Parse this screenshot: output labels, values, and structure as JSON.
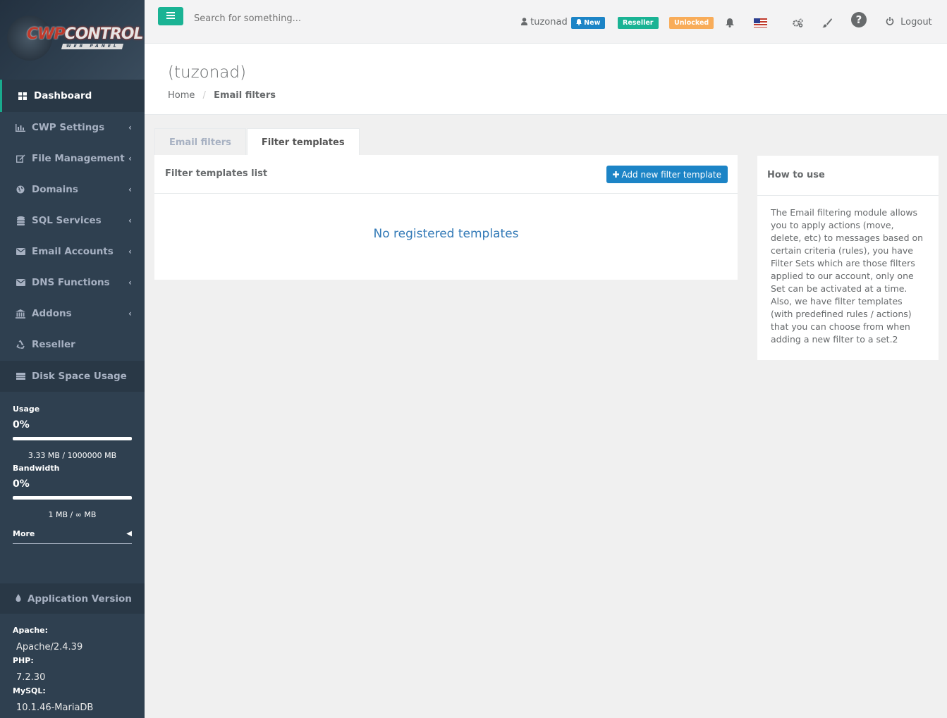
{
  "sidebar": {
    "logo": {
      "brand_left": "CWP",
      "brand_right": "CONTROL",
      "sub": "WEB PANEL"
    },
    "items": [
      {
        "label": "Dashboard",
        "icon": "dashboard-icon"
      },
      {
        "label": "CWP Settings",
        "icon": "bar-chart-icon"
      },
      {
        "label": "File Management",
        "icon": "edit-icon"
      },
      {
        "label": "Domains",
        "icon": "globe-icon"
      },
      {
        "label": "SQL Services",
        "icon": "database-icon"
      },
      {
        "label": "Email Accounts",
        "icon": "envelope-icon"
      },
      {
        "label": "DNS Functions",
        "icon": "envelope-icon"
      },
      {
        "label": "Addons",
        "icon": "bank-icon"
      },
      {
        "label": "Reseller",
        "icon": "recycle-icon"
      }
    ],
    "disk": {
      "heading": "Disk Space Usage",
      "usage_label": "Usage",
      "usage_pct": "0%",
      "usage_detail": "3.33 MB / 1000000 MB",
      "bandwidth_label": "Bandwidth",
      "bandwidth_pct": "0%",
      "bandwidth_detail": "1 MB / ∞ MB",
      "more_label": "More"
    },
    "app_version": {
      "heading": "Application Version",
      "apache_label": "Apache:",
      "apache_val": "Apache/2.4.39",
      "php_label": "PHP:",
      "php_val": "7.2.30",
      "mysql_label": "MySQL:",
      "mysql_val": "10.1.46-MariaDB"
    }
  },
  "topbar": {
    "search_placeholder": "Search for something...",
    "username": "tuzonad",
    "badge_new": "New",
    "badge_reseller": "Reseller",
    "badge_unlocked": "Unlocked",
    "logout": "Logout",
    "colors": {
      "green": "#1ab394",
      "blue": "#1c84c6",
      "orange": "#f8ac59"
    }
  },
  "page": {
    "title": "(tuzonad)",
    "breadcrumb_home": "Home",
    "breadcrumb_sep": "/",
    "breadcrumb_current": "Email filters"
  },
  "tabs": {
    "email_filters": "Email filters",
    "filter_templates": "Filter templates"
  },
  "panel": {
    "title": "Filter templates list",
    "add_button": "Add new filter template",
    "empty": "No registered templates"
  },
  "howto": {
    "title": "How to use",
    "body": "The Email filtering module allows you to apply actions (move, delete, etc) to messages based on certain criteria (rules), you have Filter Sets which are those filters applied to our account, only one Set can be activated at a time. Also, we have filter templates (with predefined rules / actions) that you can choose from when adding a new filter to a set.2"
  }
}
